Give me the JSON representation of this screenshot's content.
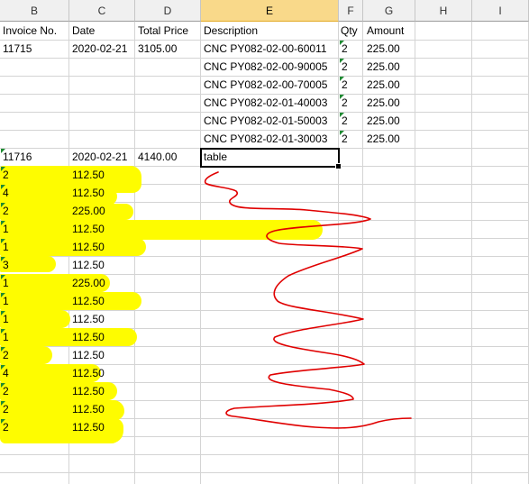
{
  "columns": [
    "B",
    "C",
    "D",
    "E",
    "F",
    "G",
    "H",
    "I"
  ],
  "header_row": {
    "invoice_no": "Invoice No.",
    "date": "Date",
    "total_price": "Total Price",
    "description": "Description",
    "qty": "Qty",
    "amount": "Amount"
  },
  "invoice1": {
    "invoice_no": "11715",
    "date": "2020-02-21",
    "total_price": "3105.00",
    "lines": [
      {
        "description": "CNC PY082-02-00-60011",
        "qty": "2",
        "amount": "225.00"
      },
      {
        "description": "CNC PY082-02-00-90005",
        "qty": "2",
        "amount": "225.00"
      },
      {
        "description": "CNC PY082-02-00-70005",
        "qty": "2",
        "amount": "225.00"
      },
      {
        "description": "CNC PY082-02-01-40003",
        "qty": "2",
        "amount": "225.00"
      },
      {
        "description": "CNC PY082-02-01-50003",
        "qty": "2",
        "amount": "225.00"
      },
      {
        "description": "CNC PY082-02-01-30003",
        "qty": "2",
        "amount": "225.00"
      }
    ]
  },
  "invoice2": {
    "invoice_no": "11716",
    "date": "2020-02-21",
    "total_price": "4140.00",
    "description": "table",
    "rows": [
      {
        "b": "2",
        "c": "112.50"
      },
      {
        "b": "4",
        "c": "112.50"
      },
      {
        "b": "2",
        "c": "225.00"
      },
      {
        "b": "1",
        "c": "112.50"
      },
      {
        "b": "1",
        "c": "112.50"
      },
      {
        "b": "3",
        "c": "112.50"
      },
      {
        "b": "1",
        "c": "225.00"
      },
      {
        "b": "1",
        "c": "112.50"
      },
      {
        "b": "1",
        "c": "112.50"
      },
      {
        "b": "1",
        "c": "112.50"
      },
      {
        "b": "2",
        "c": "112.50"
      },
      {
        "b": "4",
        "c": "112.50"
      },
      {
        "b": "2",
        "c": "112.50"
      },
      {
        "b": "2",
        "c": "112.50"
      },
      {
        "b": "2",
        "c": "112.50"
      }
    ]
  },
  "colors": {
    "highlight": "#fefc00",
    "annotation": "#e00000",
    "selected_header": "#f9d98a"
  }
}
